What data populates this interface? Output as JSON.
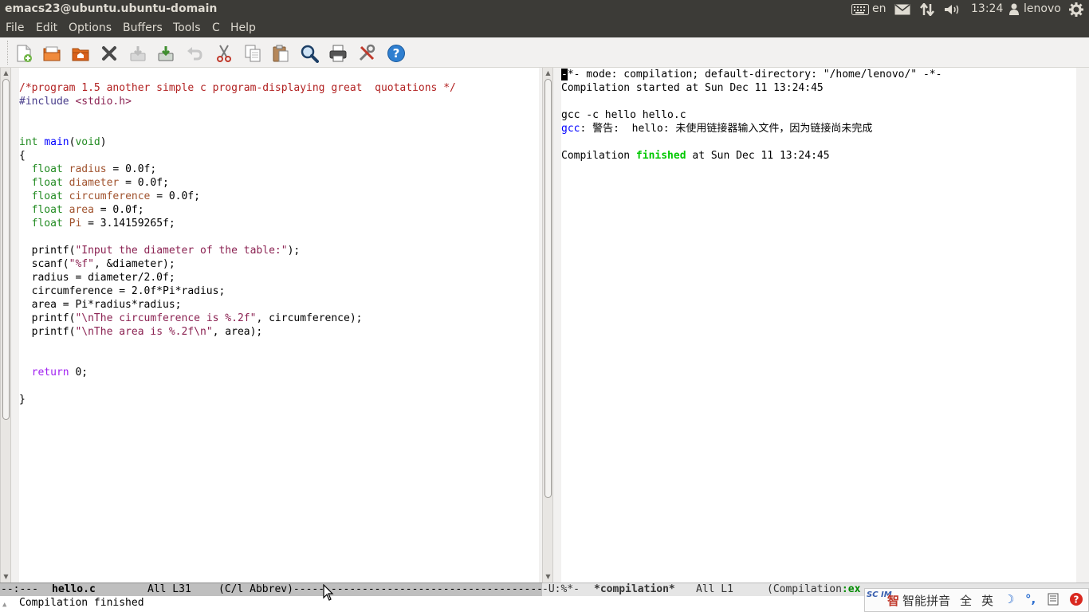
{
  "panel": {
    "window_title": "emacs23@ubuntu.ubuntu-domain",
    "keyboard_layout": "en",
    "clock": "13:24",
    "user": "lenovo"
  },
  "menu": [
    "File",
    "Edit",
    "Options",
    "Buffers",
    "Tools",
    "C",
    "Help"
  ],
  "toolbar_icons": [
    "new-file-icon",
    "open-file-icon",
    "open-directory-icon",
    "close-buffer-icon",
    "save-icon",
    "save-as-icon",
    "undo-icon",
    "cut-icon",
    "copy-icon",
    "paste-icon",
    "search-icon",
    "print-icon",
    "preferences-icon",
    "help-icon"
  ],
  "left_buffer": {
    "lines": [
      [
        {
          "t": "/*program 1.5 another simple c program-displaying great  quotations */",
          "c": "cm"
        }
      ],
      [
        {
          "t": "#include ",
          "c": "pp"
        },
        {
          "t": "<stdio.h>",
          "c": "st"
        }
      ],
      [],
      [],
      [
        {
          "t": "int",
          "c": "ty"
        },
        {
          "t": " "
        },
        {
          "t": "main",
          "c": "fn"
        },
        {
          "t": "("
        },
        {
          "t": "void",
          "c": "ty"
        },
        {
          "t": ")"
        }
      ],
      [
        {
          "t": "{"
        }
      ],
      [
        {
          "t": "  "
        },
        {
          "t": "float",
          "c": "ty"
        },
        {
          "t": " "
        },
        {
          "t": "radius",
          "c": "vr"
        },
        {
          "t": " = 0.0f;"
        }
      ],
      [
        {
          "t": "  "
        },
        {
          "t": "float",
          "c": "ty"
        },
        {
          "t": " "
        },
        {
          "t": "diameter",
          "c": "vr"
        },
        {
          "t": " = 0.0f;"
        }
      ],
      [
        {
          "t": "  "
        },
        {
          "t": "float",
          "c": "ty"
        },
        {
          "t": " "
        },
        {
          "t": "circumference",
          "c": "vr"
        },
        {
          "t": " = 0.0f;"
        }
      ],
      [
        {
          "t": "  "
        },
        {
          "t": "float",
          "c": "ty"
        },
        {
          "t": " "
        },
        {
          "t": "area",
          "c": "vr"
        },
        {
          "t": " = 0.0f;"
        }
      ],
      [
        {
          "t": "  "
        },
        {
          "t": "float",
          "c": "ty"
        },
        {
          "t": " "
        },
        {
          "t": "Pi",
          "c": "vr"
        },
        {
          "t": " = 3.14159265f;"
        }
      ],
      [],
      [
        {
          "t": "  printf("
        },
        {
          "t": "\"Input the diameter of the table:\"",
          "c": "st"
        },
        {
          "t": ");"
        }
      ],
      [
        {
          "t": "  scanf("
        },
        {
          "t": "\"%f\"",
          "c": "st"
        },
        {
          "t": ", &diameter);"
        }
      ],
      [
        {
          "t": "  radius = diameter/2.0f;"
        }
      ],
      [
        {
          "t": "  circumference = 2.0f*Pi*radius;"
        }
      ],
      [
        {
          "t": "  area = Pi*radius*radius;"
        }
      ],
      [
        {
          "t": "  printf("
        },
        {
          "t": "\"\\nThe circumference is %.2f\"",
          "c": "st"
        },
        {
          "t": ", circumference);"
        }
      ],
      [
        {
          "t": "  printf("
        },
        {
          "t": "\"\\nThe area is %.2f\\n\"",
          "c": "st"
        },
        {
          "t": ", area);"
        }
      ],
      [],
      [],
      [
        {
          "t": "  "
        },
        {
          "t": "return",
          "c": "kw"
        },
        {
          "t": " 0;"
        }
      ],
      [],
      [
        {
          "t": "}"
        }
      ]
    ]
  },
  "right_buffer": {
    "lines": [
      [
        {
          "t": "-",
          "c": "cursor"
        },
        {
          "t": "*- mode: compilation; default-directory: \"/home/lenovo/\" -*-"
        }
      ],
      [
        {
          "t": "Compilation started at Sun Dec 11 13:24:45"
        }
      ],
      [],
      [
        {
          "t": "gcc -c hello hello.c"
        }
      ],
      [
        {
          "t": "gcc",
          "c": "gcc"
        },
        {
          "t": ": 警告:  hello: 未使用链接器输入文件，因为链接尚未完成"
        }
      ],
      [],
      [
        {
          "t": "Compilation "
        },
        {
          "t": "finished",
          "c": "fin"
        },
        {
          "t": " at Sun Dec 11 13:24:45"
        }
      ]
    ]
  },
  "modeline_left": {
    "status": "--:---",
    "buffer_name": "hello.c",
    "position": "All L31",
    "modes": "(C/l Abbrev)---------------------------------------------"
  },
  "modeline_right": {
    "status": "-U:%*-",
    "buffer_name": "*compilation*",
    "position": "All L1",
    "modes_prefix": "(Compilation",
    "modes_suffix": ":ex"
  },
  "echo_area": "Compilation finished",
  "ime": {
    "logo": "SC IM",
    "name": "智能拼音",
    "full_width": "全",
    "lang": "英"
  }
}
